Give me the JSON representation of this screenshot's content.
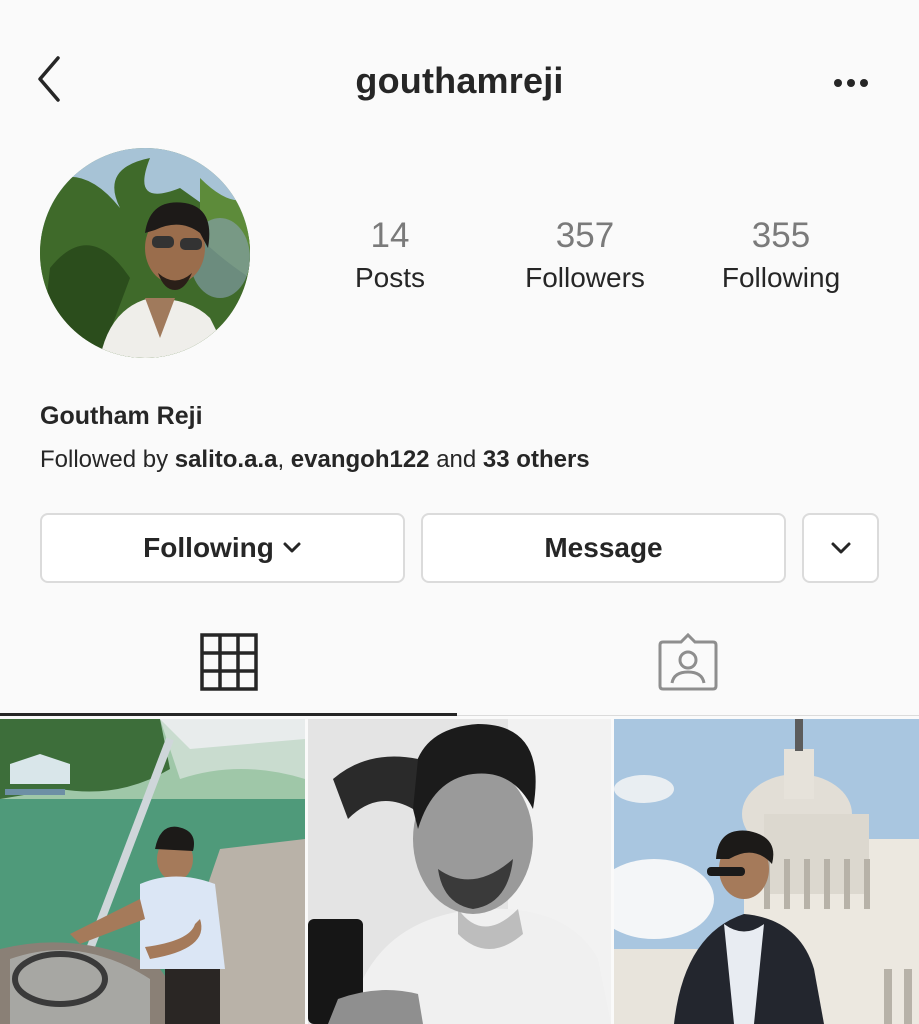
{
  "header": {
    "username": "gouthamreji",
    "back_icon": "chevron-left-icon",
    "more_icon": "more-horizontal-icon"
  },
  "profile": {
    "stats": {
      "posts": {
        "count": "14",
        "label": "Posts"
      },
      "followers": {
        "count": "357",
        "label": "Followers"
      },
      "following": {
        "count": "355",
        "label": "Following"
      }
    },
    "full_name": "Goutham Reji",
    "followed_by": {
      "prefix": "Followed by ",
      "user1": "salito.a.a",
      "separator": ", ",
      "user2": "evangoh122",
      "connector": " and ",
      "others": "33 others"
    }
  },
  "actions": {
    "following_label": "Following",
    "message_label": "Message",
    "dropdown_icon": "chevron-down-icon"
  },
  "tabs": {
    "grid_icon": "grid-icon",
    "tagged_icon": "tagged-user-icon",
    "active": "grid"
  },
  "colors": {
    "background": "#fafafa",
    "text": "#262626",
    "secondary_text": "#7a7a7a",
    "border": "#dbdbdb"
  }
}
